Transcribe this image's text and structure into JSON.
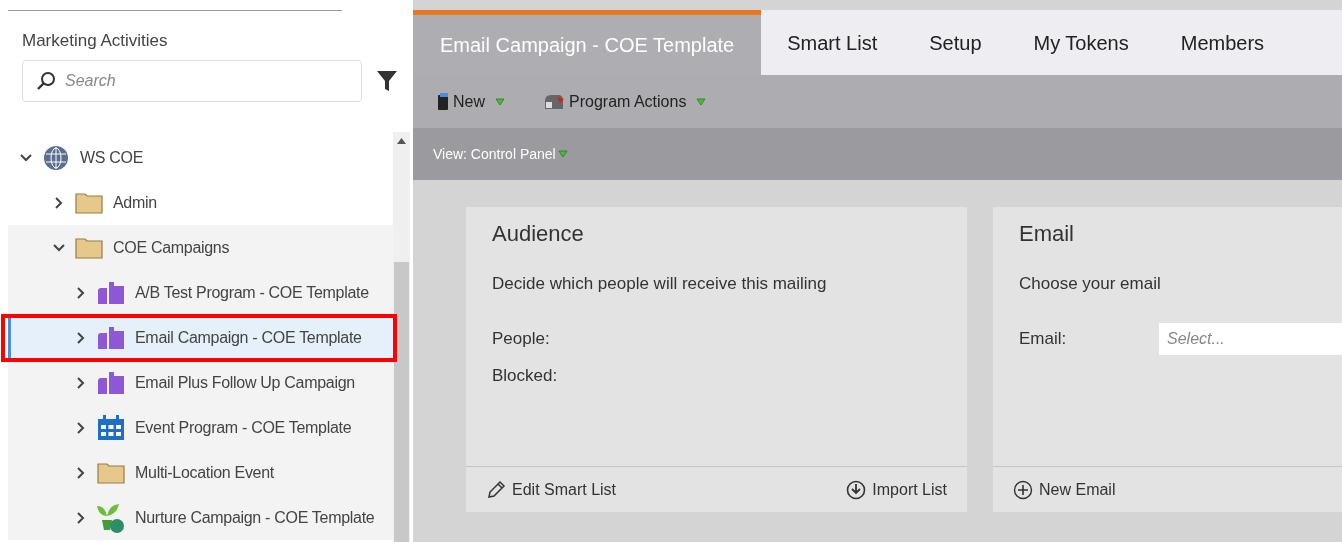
{
  "sidebar": {
    "title": "Marketing Activities",
    "search": {
      "placeholder": "Search"
    },
    "tree": [
      {
        "label": "WS COE",
        "kind": "globe",
        "expanded": true,
        "selected": false,
        "highlighted": false,
        "children": [
          {
            "label": "Admin",
            "kind": "folder",
            "expanded": false,
            "selected": false,
            "highlighted": false
          },
          {
            "label": "COE Campaigns",
            "kind": "folder",
            "expanded": true,
            "selected": false,
            "highlighted": false,
            "children": [
              {
                "label": "A/B Test Program - COE Template",
                "kind": "program",
                "expanded": false,
                "selected": false,
                "highlighted": false
              },
              {
                "label": "Email Campaign - COE Template",
                "kind": "program",
                "expanded": false,
                "selected": true,
                "highlighted": true
              },
              {
                "label": "Email Plus Follow Up Campaign",
                "kind": "program",
                "expanded": false,
                "selected": false,
                "highlighted": false
              },
              {
                "label": "Event Program - COE Template",
                "kind": "event",
                "expanded": false,
                "selected": false,
                "highlighted": false
              },
              {
                "label": "Multi-Location Event",
                "kind": "folder",
                "expanded": false,
                "selected": false,
                "highlighted": false
              },
              {
                "label": "Nurture Campaign - COE Template",
                "kind": "nurture",
                "expanded": false,
                "selected": false,
                "highlighted": false
              }
            ]
          }
        ]
      }
    ]
  },
  "tabs": [
    {
      "label": "Email Campaign - COE Template",
      "selected": true
    },
    {
      "label": "Smart List",
      "selected": false
    },
    {
      "label": "Setup",
      "selected": false
    },
    {
      "label": "My Tokens",
      "selected": false
    },
    {
      "label": "Members",
      "selected": false
    }
  ],
  "toolbar": [
    {
      "label": "New",
      "kind": "new"
    },
    {
      "label": "Program Actions",
      "kind": "actions"
    }
  ],
  "view": "View: Control Panel",
  "cards": [
    {
      "title": "Audience",
      "description": "Decide which people will receive this mailing",
      "fields": [
        {
          "label": "People:"
        },
        {
          "label": "Blocked:"
        }
      ],
      "actions": [
        {
          "label": "Edit Smart List",
          "kind": "edit"
        },
        {
          "label": "Import List",
          "kind": "import"
        }
      ]
    },
    {
      "title": "Email",
      "description": "Choose your email",
      "fields": [
        {
          "label": "Email:",
          "placeholder": "Select..."
        }
      ],
      "actions": [
        {
          "label": "New Email",
          "kind": "add"
        }
      ]
    }
  ]
}
